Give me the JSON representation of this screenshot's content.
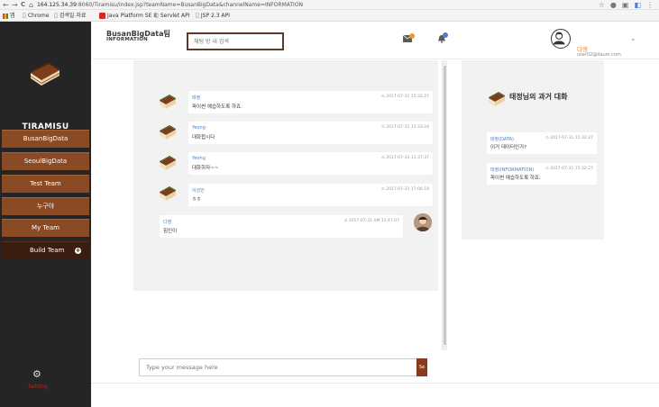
{
  "browser": {
    "back_glyph": "←",
    "forward_glyph": "→",
    "reload_glyph": "C",
    "home_glyph": "⌂",
    "url_host": "164.125.34.39",
    "url_rest": ":8060/Tiramisu/index.jsp?teamName=BusanBigData&channelName=INFORMATION",
    "star_glyph": "☆",
    "bookmarks": [
      "앱",
      "Chrome",
      "검색일 자료",
      "Java Platform SE 8",
      "Servlet API",
      "JSP 2.3 API"
    ]
  },
  "sidebar": {
    "brand": "TIRAMISU",
    "items": [
      {
        "label": "BusanBigData"
      },
      {
        "label": "SeoulBigData"
      },
      {
        "label": "Test Team"
      },
      {
        "label": "누구야"
      },
      {
        "label": "My Team"
      }
    ],
    "build_label": "Build Team",
    "build_plus": "+",
    "setting_label": "Setting",
    "setting_glyph": "⚙"
  },
  "header": {
    "team_title": "BusanBigData팀",
    "channel_name": "INFORMATION",
    "search_placeholder": "채팅 방 내 검색",
    "user_name": "다영",
    "user_email": "user02@daum.com",
    "chevron_glyph": "⌄"
  },
  "chat": {
    "messages": [
      {
        "user": "태정",
        "time": "2017-07-31 15:32:27",
        "text": "파이썬 예습하도록 하죠."
      },
      {
        "user": "Yeong",
        "time": "2017-07-31 11:33:24",
        "text": "대화합시다"
      },
      {
        "user": "Yeong",
        "time": "2017-07-31 11:37:37",
        "text": "대화하자~~"
      },
      {
        "user": "이성민",
        "time": "2017-07-31 17:08:18",
        "text": "ㅎㅎ"
      },
      {
        "user": "다영",
        "time": "2017-07-31 AM 11:47:07",
        "text": "힘인이"
      }
    ],
    "input_placeholder": "Type your message here",
    "send_label": "Se"
  },
  "history": {
    "title": "태정님의 과거 대화",
    "items": [
      {
        "channel": "태정(DATA)",
        "time": "2017-07-31 15:32:27",
        "text": "이거 데이터인가?"
      },
      {
        "channel": "태정(INFORMATION)",
        "time": "2017-07-31 15:32:27",
        "text": "파이썬 예습하도록 하죠."
      }
    ]
  },
  "colors": {
    "sidebar_bg": "#252525",
    "sidebar_item": "#8a4a24",
    "build_item": "#3a1d10",
    "accent_orange": "#e89a2e",
    "accent_blue": "#4f7fc0",
    "setting_red": "#c0201a"
  }
}
